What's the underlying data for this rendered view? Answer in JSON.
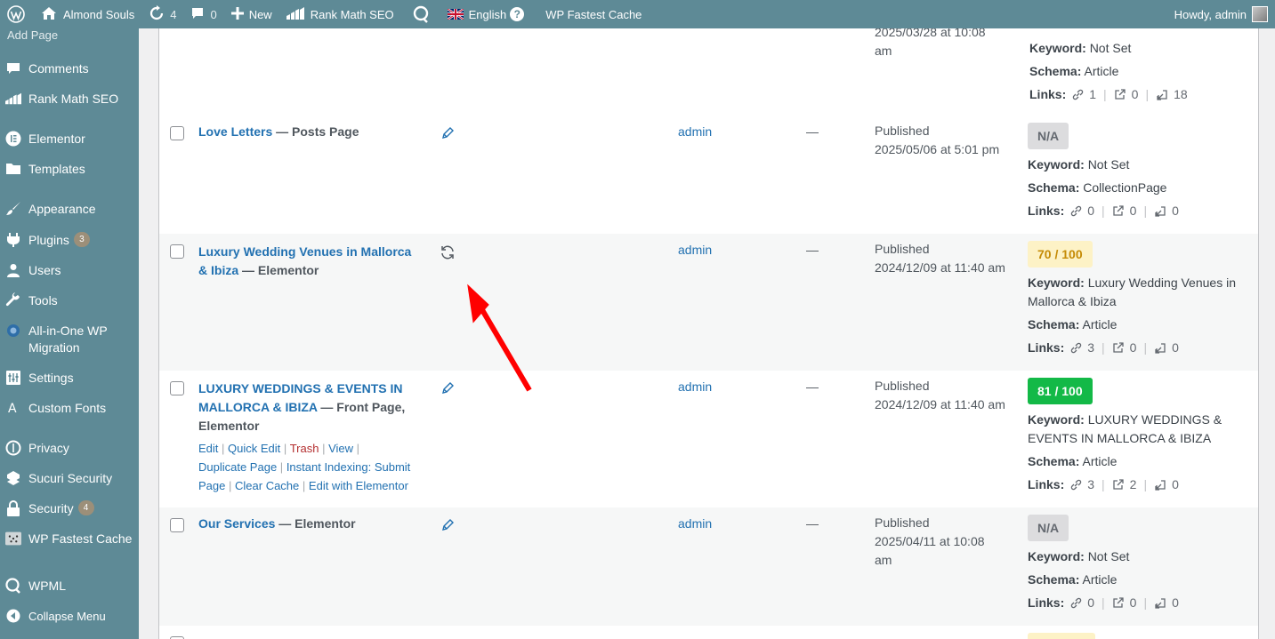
{
  "adminbar": {
    "site_name": "Almond Souls",
    "updates_count": "4",
    "comments_count": "0",
    "new_label": "New",
    "rankmath_label": "Rank Math SEO",
    "language_label": "English",
    "cache_label": "WP Fastest Cache",
    "howdy": "Howdy, admin"
  },
  "sidebar": {
    "submenu_item": "Add Page",
    "items": [
      {
        "label": "Comments",
        "icon": "comment-icon"
      },
      {
        "label": "Rank Math SEO",
        "icon": "rankmath-icon"
      },
      {
        "label": "Elementor",
        "icon": "elementor-icon"
      },
      {
        "label": "Templates",
        "icon": "folder-icon"
      },
      {
        "label": "Appearance",
        "icon": "paintbrush-icon"
      },
      {
        "label": "Plugins",
        "icon": "plugin-icon",
        "badge": "3"
      },
      {
        "label": "Users",
        "icon": "user-icon"
      },
      {
        "label": "Tools",
        "icon": "wrench-icon"
      },
      {
        "label": "All-in-One WP Migration",
        "icon": "migration-icon"
      },
      {
        "label": "Settings",
        "icon": "settings-icon"
      },
      {
        "label": "Custom Fonts",
        "icon": "font-icon"
      },
      {
        "label": "Privacy",
        "icon": "privacy-icon"
      },
      {
        "label": "Sucuri Security",
        "icon": "sucuri-icon"
      },
      {
        "label": "Security",
        "icon": "lock-icon",
        "badge": "4"
      },
      {
        "label": "WP Fastest Cache",
        "icon": "cheetah-icon"
      },
      {
        "label": "WPML",
        "icon": "wpml-icon"
      },
      {
        "label": "Collapse Menu",
        "icon": "collapse-icon"
      }
    ]
  },
  "rows": {
    "r0": {
      "date_value": "2025/03/28 at 10:08",
      "date_tail": "am",
      "keyword_label": "Keyword:",
      "keyword": "Not Set",
      "schema_label": "Schema:",
      "schema": "Article",
      "links_label": "Links:",
      "internal": "1",
      "external": "0",
      "incoming": "18"
    },
    "r1": {
      "title": "Love Letters",
      "suffix": " — Posts Page",
      "author": "admin",
      "dash": "—",
      "status": "Published",
      "date": "2025/05/06 at 5:01 pm",
      "score": "N/A",
      "keyword_label": "Keyword:",
      "keyword": "Not Set",
      "schema_label": "Schema:",
      "schema": "CollectionPage",
      "links_label": "Links:",
      "internal": "0",
      "external": "0",
      "incoming": "0"
    },
    "r2": {
      "title_line1": "Luxury Wedding Venues in Mallorca",
      "title_line2": "& Ibiza",
      "suffix": " — Elementor",
      "author": "admin",
      "dash": "—",
      "status": "Published",
      "date": "2024/12/09 at 11:40 am",
      "score": "70 / 100",
      "keyword_label": "Keyword:",
      "keyword_line1": "Luxury Wedding Venues in",
      "keyword_line2": "Mallorca & Ibiza",
      "schema_label": "Schema:",
      "schema": "Article",
      "links_label": "Links:",
      "internal": "3",
      "external": "0",
      "incoming": "0"
    },
    "r3": {
      "title_line1": "LUXURY WEDDINGS & EVENTS IN",
      "title_line2": "MALLORCA & IBIZA",
      "suffix": " — Front Page,",
      "suffix_line3": "Elementor",
      "actions": {
        "edit": "Edit",
        "quick_edit": "Quick Edit",
        "trash": "Trash",
        "view": "View",
        "duplicate": "Duplicate Page",
        "instant_indexing": "Instant Indexing: Submit",
        "instant_indexing2": "Page",
        "clear_cache": "Clear Cache",
        "edit_elementor": "Edit with Elementor",
        "sep": "|"
      },
      "author": "admin",
      "dash": "—",
      "status": "Published",
      "date": "2024/12/09 at 11:40 am",
      "score": "81 / 100",
      "keyword_label": "Keyword:",
      "keyword_line1": "LUXURY WEDDINGS &",
      "keyword_line2": "EVENTS IN MALLORCA & IBIZA",
      "schema_label": "Schema:",
      "schema": "Article",
      "links_label": "Links:",
      "internal": "3",
      "external": "2",
      "incoming": "0"
    },
    "r4": {
      "title": "Our Services",
      "suffix": " — Elementor",
      "author": "admin",
      "dash": "—",
      "status": "Published",
      "date_line1": "2025/04/11 at 10:08",
      "date_line2": "am",
      "score": "N/A",
      "keyword_label": "Keyword:",
      "keyword": "Not Set",
      "schema_label": "Schema:",
      "schema": "Article",
      "links_label": "Links:",
      "internal": "0",
      "external": "0",
      "incoming": "0"
    }
  },
  "colors": {
    "sidebar_bg": "#5e8a96",
    "link": "#2271b1",
    "score_good": "#13b947",
    "score_mid_bg": "#fdf2c6",
    "arrow": "#ff0000"
  }
}
